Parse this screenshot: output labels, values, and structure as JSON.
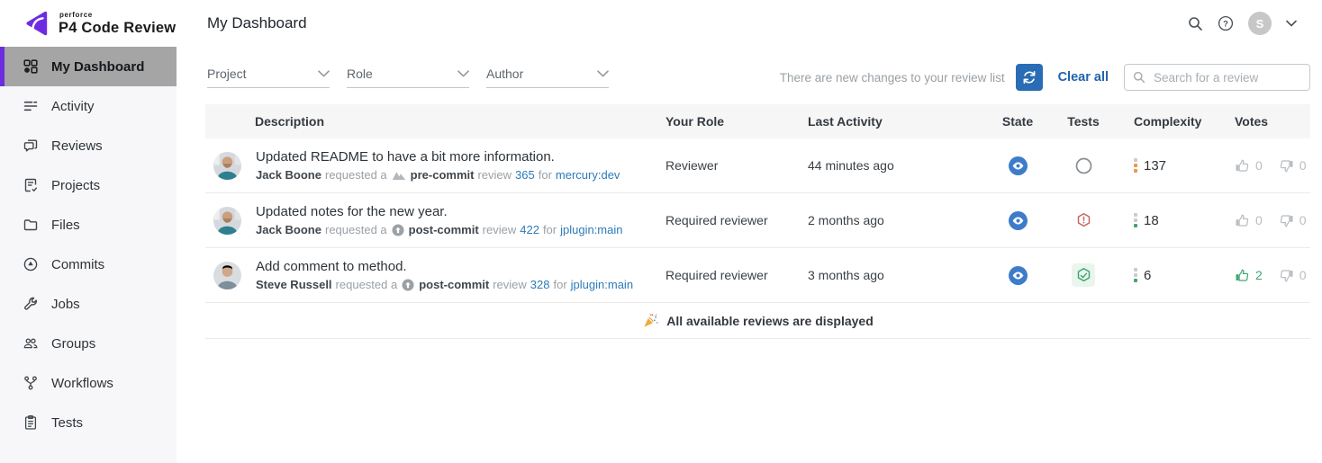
{
  "colors": {
    "accent_purple": "#6e2ce0",
    "link_blue": "#2d7bb9",
    "action_blue": "#2a6cb5",
    "state_blue": "#3d7cc9",
    "test_fail_red": "#c4625e",
    "test_pass_green": "#3aa66d",
    "complexity_orange": "#e89a4f",
    "complexity_green": "#47a46b",
    "vote_green": "#43a573",
    "selected_item_gray": "#a5a5a5"
  },
  "topbar": {
    "brand_superscript": "perforce",
    "brand_name": "P4 Code Review",
    "page_title": "My Dashboard",
    "avatar_initial": "S"
  },
  "sidebar": {
    "items": [
      {
        "label": "My Dashboard",
        "icon": "dashboard",
        "active": true
      },
      {
        "label": "Activity",
        "icon": "activity",
        "active": false
      },
      {
        "label": "Reviews",
        "icon": "reviews",
        "active": false
      },
      {
        "label": "Projects",
        "icon": "projects",
        "active": false
      },
      {
        "label": "Files",
        "icon": "files",
        "active": false
      },
      {
        "label": "Commits",
        "icon": "commits",
        "active": false
      },
      {
        "label": "Jobs",
        "icon": "jobs",
        "active": false
      },
      {
        "label": "Groups",
        "icon": "groups",
        "active": false
      },
      {
        "label": "Workflows",
        "icon": "workflows",
        "active": false
      },
      {
        "label": "Tests",
        "icon": "tests",
        "active": false
      }
    ]
  },
  "filters": [
    {
      "label": "Project"
    },
    {
      "label": "Role"
    },
    {
      "label": "Author"
    }
  ],
  "notice": {
    "text": "There are new changes to your review list",
    "clear_all_label": "Clear all"
  },
  "search": {
    "placeholder": "Search for a review"
  },
  "table": {
    "columns": [
      "Description",
      "Your Role",
      "Last Activity",
      "State",
      "Tests",
      "Complexity",
      "Votes"
    ],
    "rows": [
      {
        "title": "Updated README to have a bit more information.",
        "author": "Jack Boone",
        "requested": "requested a",
        "commit_type": "pre-commit",
        "review_word": "review",
        "review_id": "365",
        "for_word": "for",
        "target": "mercury:dev",
        "avatar": "jack",
        "role": "Reviewer",
        "last_activity": "44 minutes ago",
        "state": "viewing",
        "tests": "pending",
        "complexity": "137",
        "complexity_dots": [
          "gray",
          "orange",
          "orange"
        ],
        "votes_up": "0",
        "votes_down": "0",
        "up_active": false
      },
      {
        "title": "Updated notes for the new year.",
        "author": "Jack Boone",
        "requested": "requested a",
        "commit_type": "post-commit",
        "review_word": "review",
        "review_id": "422",
        "for_word": "for",
        "target": "jplugin:main",
        "avatar": "jack",
        "role": "Required reviewer",
        "last_activity": "2 months ago",
        "state": "viewing",
        "tests": "failed",
        "complexity": "18",
        "complexity_dots": [
          "gray",
          "gray",
          "green"
        ],
        "votes_up": "0",
        "votes_down": "0",
        "up_active": false
      },
      {
        "title": "Add comment to method.",
        "author": "Steve Russell",
        "requested": "requested a",
        "commit_type": "post-commit",
        "review_word": "review",
        "review_id": "328",
        "for_word": "for",
        "target": "jplugin:main",
        "avatar": "steve",
        "role": "Required reviewer",
        "last_activity": "3 months ago",
        "state": "viewing",
        "tests": "passed",
        "complexity": "6",
        "complexity_dots": [
          "gray",
          "gray",
          "green"
        ],
        "votes_up": "2",
        "votes_down": "0",
        "up_active": true
      }
    ]
  },
  "footer": {
    "message": "All available reviews are displayed"
  }
}
